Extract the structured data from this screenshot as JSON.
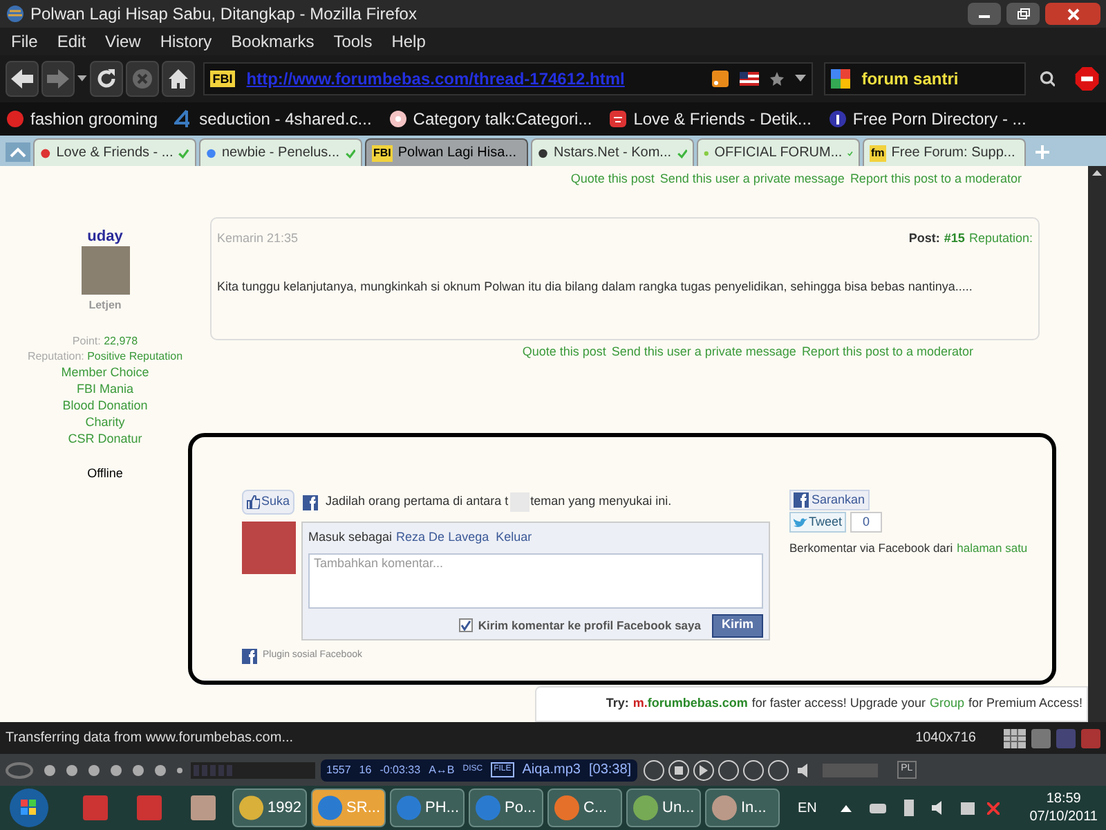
{
  "window": {
    "title": "Polwan Lagi Hisap Sabu, Ditangkap - Mozilla Firefox"
  },
  "menu": [
    "File",
    "Edit",
    "View",
    "History",
    "Bookmarks",
    "Tools",
    "Help"
  ],
  "toolbar": {
    "url": "http://www.forumbebas.com/thread-174612.html",
    "site_badge": "FBI",
    "search": "forum santri"
  },
  "bookmarks": [
    {
      "label": "fashion grooming"
    },
    {
      "label": "seduction - 4shared.c..."
    },
    {
      "label": "Category talk:Categori..."
    },
    {
      "label": "Love & Friends - Detik..."
    },
    {
      "label": "Free Porn Directory - ..."
    }
  ],
  "tabs": [
    {
      "label": "Love & Friends - ...",
      "selected": false
    },
    {
      "label": "newbie - Penelus...",
      "selected": false
    },
    {
      "label": "Polwan Lagi Hisa...",
      "selected": true,
      "badge": "FBI"
    },
    {
      "label": "Nstars.Net - Kom...",
      "selected": false
    },
    {
      "label": "OFFICIAL FORUM...",
      "selected": false
    },
    {
      "label": "Free Forum: Supp...",
      "selected": false,
      "badge": "fm"
    }
  ],
  "post_links_top": [
    "Quote this post",
    "Send this user a private message",
    "Report this post to a moderator"
  ],
  "user": {
    "name": "uday",
    "rank": "Letjen",
    "point_label": "Point:",
    "points": "22,978",
    "reputation_label": "Reputation:",
    "reputation": "Positive Reputation",
    "awards": [
      "Member Choice",
      "FBI Mania",
      "Blood Donation",
      "Charity",
      "CSR Donatur"
    ],
    "status": "Offline"
  },
  "post": {
    "date": "Kemarin 21:35",
    "post_label": "Post:",
    "number": "#15",
    "reputation_label": "Reputation:",
    "text": "Kita tunggu kelanjutanya, mungkinkah si oknum Polwan itu dia bilang dalam rangka tugas penyelidikan, sehingga bisa bebas nantinya....."
  },
  "post_links_bottom": [
    "Quote this post",
    "Send this user a private message",
    "Report this post to a moderator"
  ],
  "facebook": {
    "like_button": "Suka",
    "like_text": "Jadilah orang pertama di antara t",
    "like_text_2": "teman yang menyukai ini.",
    "login_prefix": "Masuk sebagai",
    "user": "Reza De Lavega",
    "logout": "Keluar",
    "comment_placeholder": "Tambahkan komentar...",
    "post_to_profile": {
      "label": "Kirim komentar ke profil Facebook saya",
      "checked": true
    },
    "submit": "Kirim",
    "plugin": "Plugin sosial Facebook",
    "recommend": "Sarankan",
    "tweet": "Tweet",
    "tweet_count": "0",
    "via_text": "Berkomentar via Facebook dari",
    "via_link": "halaman satu"
  },
  "banner": {
    "try": "Try:",
    "mobile_prefix": "m.",
    "mobile_domain": "forumbebas.com",
    "text1": "for faster access! Upgrade your",
    "group": "Group",
    "text2": "for Premium Access!"
  },
  "status_bar": {
    "text": "Transferring data from www.forumbebas.com...",
    "size": "1040x716"
  },
  "player": {
    "bitrate": "1557",
    "khz": "16",
    "time": "-0:03:33",
    "ab": "A↔B",
    "disc": "DISC",
    "file": "FILE",
    "track": "Aiqa.mp3",
    "length": "[03:38]",
    "pl": "PL"
  },
  "taskbar": {
    "buttons": [
      {
        "label": "1992",
        "selected": false
      },
      {
        "label": "SR...",
        "selected": true
      },
      {
        "label": "PH...",
        "selected": false
      },
      {
        "label": "Po...",
        "selected": false
      },
      {
        "label": "C...",
        "selected": false
      },
      {
        "label": "Un...",
        "selected": false
      },
      {
        "label": "In...",
        "selected": false
      }
    ],
    "language": "EN",
    "time": "18:59",
    "date": "07/10/2011"
  }
}
